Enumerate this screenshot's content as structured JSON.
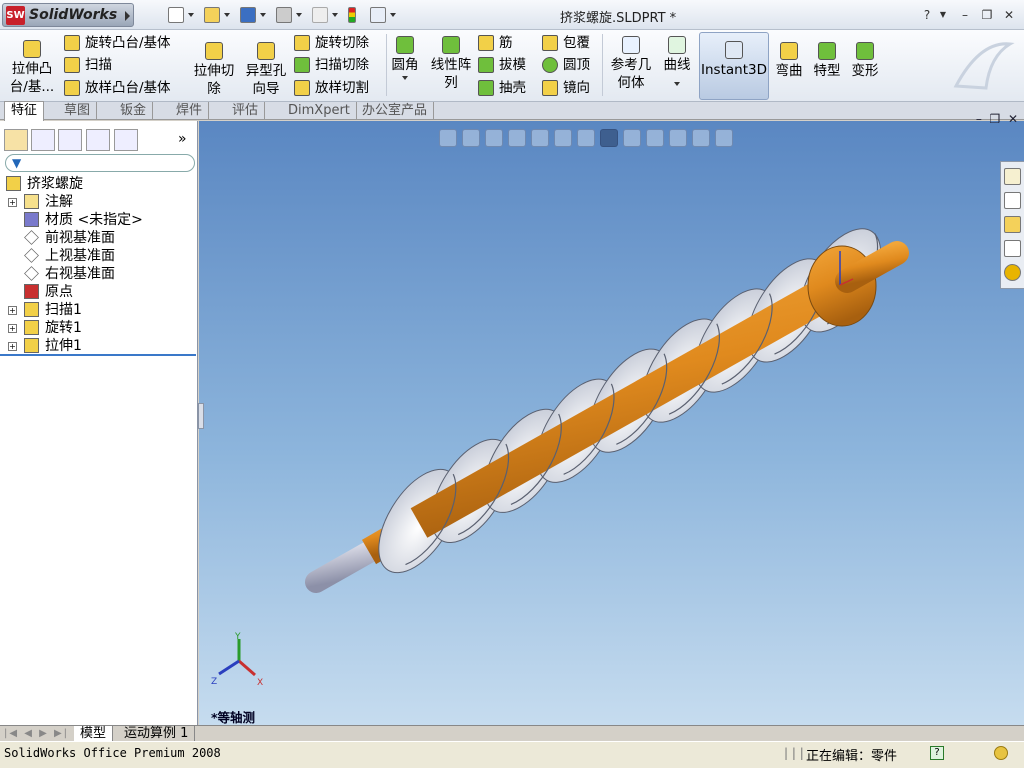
{
  "app": {
    "name": "SolidWorks",
    "logo_badge": "SW",
    "title": "挤浆螺旋.SLDPRT *",
    "product": "SolidWorks Office Premium 2008"
  },
  "ribbon": {
    "extrude_boss": "拉伸凸\n台/基...",
    "revolve_boss": "旋转凸台/基体",
    "sweep": "扫描",
    "loft_boss": "放样凸台/基体",
    "extrude_cut": "拉伸切\n除",
    "hole_wizard": "异型孔\n向导",
    "revolve_cut": "旋转切除",
    "sweep_cut": "扫描切除",
    "loft_cut": "放样切割",
    "fillet": "圆角",
    "linear_pattern": "线性阵\n列",
    "rib": "筋",
    "draft": "拔模",
    "shell": "抽壳",
    "wrap": "包覆",
    "dome": "圆顶",
    "mirror": "镜向",
    "ref_geometry": "参考几\n何体",
    "curves": "曲线",
    "instant3d": "Instant3D",
    "flex": "弯曲",
    "features": "特型",
    "deform": "变形"
  },
  "tabs": [
    "特征",
    "草图",
    "钣金",
    "焊件",
    "评估",
    "DimXpert",
    "办公室产品"
  ],
  "tree": [
    {
      "label": "挤浆螺旋",
      "expand": false,
      "icon": "part-icon"
    },
    {
      "label": "注解",
      "expand": true,
      "icon": "annotation-icon"
    },
    {
      "label": "材质 <未指定>",
      "expand": false,
      "icon": "material-icon"
    },
    {
      "label": "前视基准面",
      "expand": false,
      "icon": "plane-icon"
    },
    {
      "label": "上视基准面",
      "expand": false,
      "icon": "plane-icon"
    },
    {
      "label": "右视基准面",
      "expand": false,
      "icon": "plane-icon"
    },
    {
      "label": "原点",
      "expand": false,
      "icon": "origin-icon"
    },
    {
      "label": "扫描1",
      "expand": true,
      "icon": "sweep-icon"
    },
    {
      "label": "旋转1",
      "expand": true,
      "icon": "revolve-icon"
    },
    {
      "label": "拉伸1",
      "expand": true,
      "icon": "extrude-icon"
    }
  ],
  "viewport": {
    "view_label": "*等轴测",
    "triad": {
      "x": "X",
      "y": "Y",
      "z": "Z"
    }
  },
  "bottom_tabs": [
    "模型",
    "运动算例 1"
  ],
  "status": {
    "editing": "正在编辑：零件"
  },
  "colors": {
    "shaft": "#e08a1e",
    "flight": "#eef1f6",
    "viewport_top": "#5a87c2",
    "viewport_bottom": "#c6dcef"
  }
}
